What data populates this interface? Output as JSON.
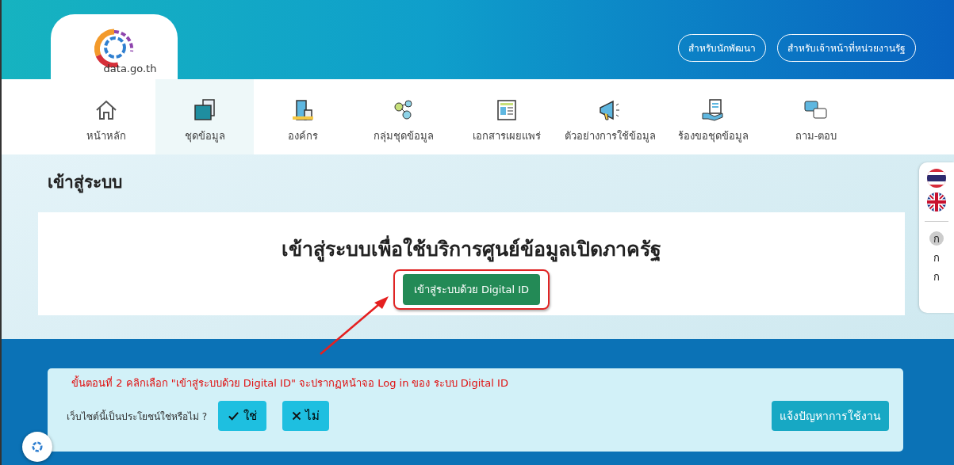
{
  "logo": {
    "text": "data.go.th"
  },
  "header_links": [
    "สำหรับนักพัฒนา",
    "สำหรับเจ้าหน้าที่หน่วยงานรัฐ"
  ],
  "nav": [
    {
      "label": "หน้าหลัก",
      "kind": "home",
      "selected": false
    },
    {
      "label": "ชุดข้อมูล",
      "kind": "dataset",
      "selected": true
    },
    {
      "label": "องค์กร",
      "kind": "organization",
      "selected": false
    },
    {
      "label": "กลุ่มชุดข้อมูล",
      "kind": "group",
      "selected": false
    },
    {
      "label": "เอกสารเผยแพร่",
      "kind": "document",
      "selected": false
    },
    {
      "label": "ตัวอย่างการใช้ข้อมูล",
      "kind": "showcase",
      "selected": false
    },
    {
      "label": "ร้องขอชุดข้อมูล",
      "kind": "request",
      "selected": false
    },
    {
      "label": "ถาม-ตอบ",
      "kind": "qa",
      "selected": false
    }
  ],
  "page_title": "เข้าสู่ระบบ",
  "login_card": {
    "heading": "เข้าสู่ระบบเพื่อใช้บริการศูนย์ข้อมูลเปิดภาครัฐ",
    "button": "เข้าสู่ระบบด้วย Digital ID"
  },
  "annotation": "ขั้นตอนที่ 2 คลิกเลือก \"เข้าสู่ระบบด้วย Digital ID\" จะปรากฏหน้าจอ Log in ของ ระบบ Digital ID",
  "feedback": {
    "question": "เว็บไซต์นี้เป็นประโยชน์ใช่หรือไม่ ?",
    "yes": "ใช่",
    "no": "ไม่",
    "report": "แจ้งปัญหาการใช้งาน"
  },
  "font_sizes": [
    {
      "label": "ก",
      "selected": true
    },
    {
      "label": "ก",
      "selected": false
    },
    {
      "label": "ก",
      "selected": false
    }
  ]
}
